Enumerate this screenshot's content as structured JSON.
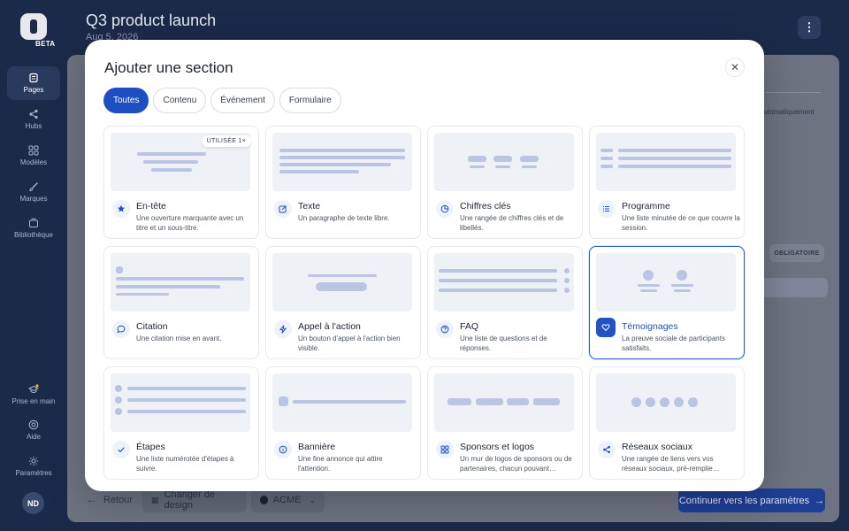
{
  "app": {
    "beta_label": "BETA",
    "user_initials": "ND"
  },
  "sidebar": {
    "items": [
      {
        "label": "Pages",
        "icon": "pages-icon",
        "active": true
      },
      {
        "label": "Hubs",
        "icon": "share-icon"
      },
      {
        "label": "Modèles",
        "icon": "grid-icon"
      },
      {
        "label": "Marques",
        "icon": "brush-icon"
      },
      {
        "label": "Bibliothèque",
        "icon": "library-icon"
      }
    ],
    "bottom_items": [
      {
        "label": "Prise en main",
        "icon": "graduation-icon"
      },
      {
        "label": "Aide",
        "icon": "help-icon"
      },
      {
        "label": "Paramètres",
        "icon": "settings-icon"
      }
    ]
  },
  "header": {
    "title": "Q3 product launch",
    "date": "Aug 5, 2026",
    "menu_glyph": "⋮"
  },
  "background": {
    "ghost_text_1": "automatiquement",
    "ghost_badge": "OBLIGATOIRE",
    "retour_label": "Retour",
    "design_label": "Changer de design",
    "brand_label": "ACME",
    "continue_label": "Continuer vers les paramètres",
    "continue_arrow": "→"
  },
  "modal": {
    "title": "Ajouter une section",
    "close_glyph": "✕",
    "tabs": [
      {
        "label": "Toutes",
        "active": true
      },
      {
        "label": "Contenu"
      },
      {
        "label": "Événement"
      },
      {
        "label": "Formulaire"
      }
    ],
    "cards": [
      {
        "name": "En-tête",
        "desc": "Une ouverture marquante avec un titre et un sous-titre.",
        "icon": "star-icon",
        "badge": "UTILISÉE 1×"
      },
      {
        "name": "Texte",
        "desc": "Un paragraphe de texte libre.",
        "icon": "edit-icon"
      },
      {
        "name": "Chiffres clés",
        "desc": "Une rangée de chiffres clés et de libellés.",
        "icon": "chart-pie-icon"
      },
      {
        "name": "Programme",
        "desc": "Une liste minutée de ce que couvre la session.",
        "icon": "list-icon"
      },
      {
        "name": "Citation",
        "desc": "Une citation mise en avant.",
        "icon": "chat-icon"
      },
      {
        "name": "Appel à l'action",
        "desc": "Un bouton d'appel à l'action bien visible.",
        "icon": "bolt-icon"
      },
      {
        "name": "FAQ",
        "desc": "Une liste de questions et de réponses.",
        "icon": "question-icon"
      },
      {
        "name": "Témoignages",
        "desc": "La preuve sociale de participants satisfaits.",
        "icon": "heart-icon",
        "selected": true
      },
      {
        "name": "Étapes",
        "desc": "Une liste numérotée d'étapes à suivre.",
        "icon": "check-icon"
      },
      {
        "name": "Bannière",
        "desc": "Une fine annonce qui attire l'attention.",
        "icon": "info-icon"
      },
      {
        "name": "Sponsors et logos",
        "desc": "Un mur de logos de sponsors ou de partenaires, chacun pouvant…",
        "icon": "apps-icon"
      },
      {
        "name": "Réseaux sociaux",
        "desc": "Une rangée de liens vers vos réseaux sociaux, pré-remplie…",
        "icon": "share-icon"
      }
    ]
  },
  "colors": {
    "accent": "#1e4fc2",
    "sidebar_bg": "#1c2a4a",
    "thumb_line": "#b9c5e2"
  }
}
